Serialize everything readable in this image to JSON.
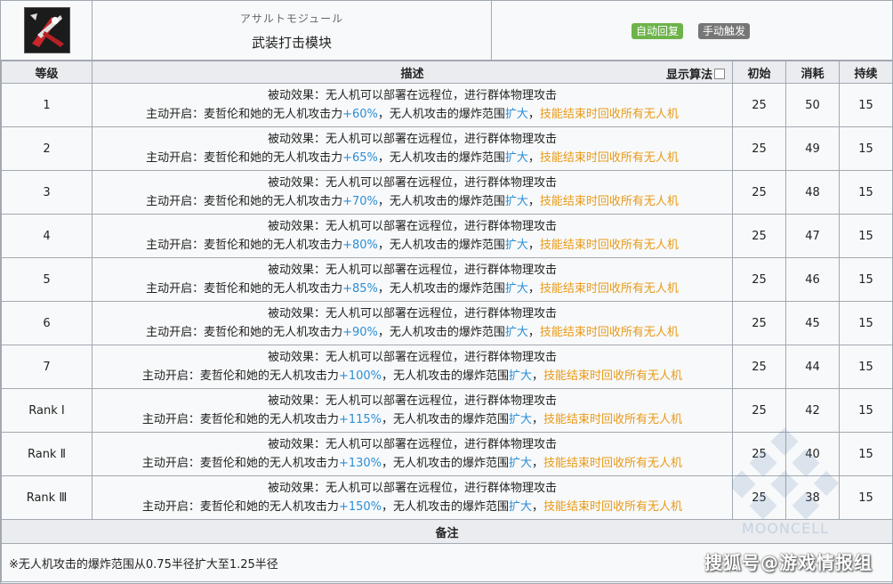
{
  "header": {
    "name_jp": "アサルトモジュール",
    "name_cn": "武装打击模块",
    "tags": [
      "自动回复",
      "手动触发"
    ],
    "icon": "drone-attack-skill-icon"
  },
  "table": {
    "columns": {
      "level": "等级",
      "desc": "描述",
      "show_algo": "显示算法",
      "initial": "初始",
      "cost": "消耗",
      "duration": "持续"
    },
    "passive_text": "被动效果：无人机可以部署在远程位，进行群体物理攻击",
    "active_prefix": "主动开启：麦哲伦和她的无人机攻击力",
    "mid_text": "，无人机攻击的爆炸范围",
    "expand_text": "扩大",
    "comma": "，",
    "recall_text": "技能结束时回收所有无人机",
    "rows": [
      {
        "level": "1",
        "atk": "+60%",
        "initial": "25",
        "cost": "50",
        "duration": "15"
      },
      {
        "level": "2",
        "atk": "+65%",
        "initial": "25",
        "cost": "49",
        "duration": "15"
      },
      {
        "level": "3",
        "atk": "+70%",
        "initial": "25",
        "cost": "48",
        "duration": "15"
      },
      {
        "level": "4",
        "atk": "+80%",
        "initial": "25",
        "cost": "47",
        "duration": "15"
      },
      {
        "level": "5",
        "atk": "+85%",
        "initial": "25",
        "cost": "46",
        "duration": "15"
      },
      {
        "level": "6",
        "atk": "+90%",
        "initial": "25",
        "cost": "45",
        "duration": "15"
      },
      {
        "level": "7",
        "atk": "+100%",
        "initial": "25",
        "cost": "44",
        "duration": "15"
      },
      {
        "level": "Rank Ⅰ",
        "atk": "+115%",
        "initial": "25",
        "cost": "42",
        "duration": "15"
      },
      {
        "level": "Rank Ⅱ",
        "atk": "+130%",
        "initial": "25",
        "cost": "40",
        "duration": "15"
      },
      {
        "level": "Rank Ⅲ",
        "atk": "+150%",
        "initial": "25",
        "cost": "38",
        "duration": "15"
      }
    ],
    "notes_title": "备注",
    "notes_text": "※无人机攻击的爆炸范围从0.75半径扩大至1.25半径"
  },
  "watermark": {
    "text": "搜狐号@游戏情报组",
    "logo_text": "MOONCELL"
  },
  "colors": {
    "value_blue": "#2b8fd6",
    "highlight_orange": "#e89a18",
    "tag_green": "#6db34a",
    "tag_gray": "#767676"
  }
}
